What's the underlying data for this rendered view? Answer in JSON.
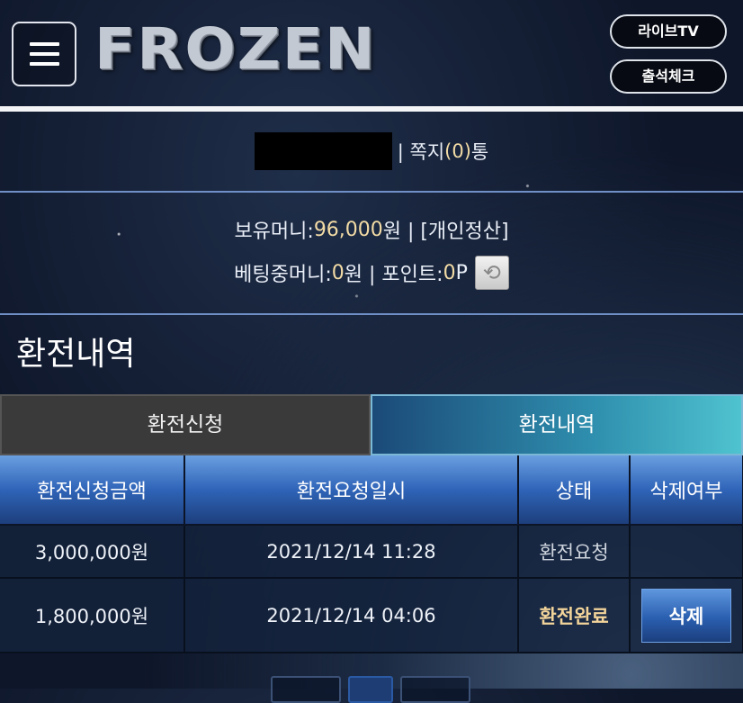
{
  "header": {
    "logo_text": "FROZEN",
    "live_tv_label": "라이브TV",
    "attendance_label": "출석체크"
  },
  "user": {
    "message_prefix": "| 쪽지 ",
    "message_count": "(0)",
    "message_suffix": " 통"
  },
  "money": {
    "balance_label": "보유머니: ",
    "balance_value": "96,000",
    "balance_unit": " 원 | [개인정산]",
    "betting_label": "베팅중머니: ",
    "betting_value": "0",
    "betting_unit": " 원 | 포인트: ",
    "points_value": "0",
    "points_unit": " P"
  },
  "section_title": "환전내역",
  "tabs": [
    {
      "label": "환전신청",
      "active": false
    },
    {
      "label": "환전내역",
      "active": true
    }
  ],
  "table": {
    "headers": [
      "환전신청금액",
      "환전요청일시",
      "상태",
      "삭제여부"
    ],
    "rows": [
      {
        "amount": "3,000,000원",
        "datetime": "2021/12/14 11:28",
        "status": "환전요청",
        "action": ""
      },
      {
        "amount": "1,800,000원",
        "datetime": "2021/12/14 04:06",
        "status": "환전완료",
        "action": "삭제"
      }
    ]
  },
  "icons": {
    "menu": "hamburger-icon",
    "refresh": "refresh-icon"
  },
  "colors": {
    "highlight": "#f2dba5",
    "accent_blue": "#2f64b8",
    "tab_active": "#2f8fae"
  }
}
